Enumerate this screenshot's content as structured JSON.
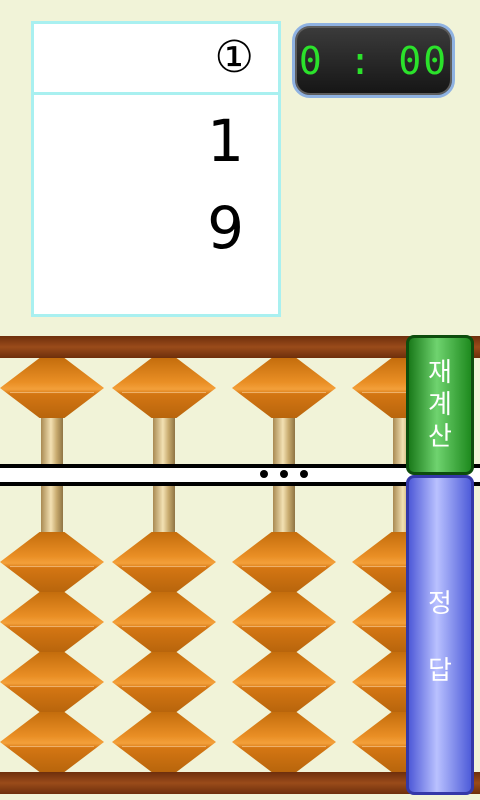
{
  "problem": {
    "number": "①",
    "operands": [
      "1",
      "9"
    ]
  },
  "timer": {
    "display": "0 : 00"
  },
  "abacus": {
    "rods_visible": 4,
    "colors": {
      "frame": "#7a3610",
      "bead": "#e88c22",
      "rod": "#e6d09a",
      "beam": "#ffffff"
    }
  },
  "buttons": {
    "recalculate": [
      "재",
      "계",
      "산"
    ],
    "answer": [
      "정",
      "답"
    ]
  },
  "colors": {
    "background": "#f1f3d8",
    "card_border": "#a9f0f0",
    "timer_text": "#2be22b"
  }
}
